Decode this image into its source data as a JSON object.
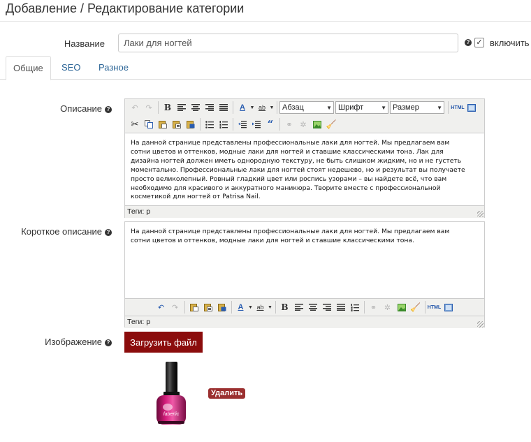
{
  "page": {
    "title": "Добавление / Редактирование категории"
  },
  "form": {
    "name_label": "Название",
    "name_value": "Лаки для ногтей",
    "enable_label": "включить",
    "enable_checked": true
  },
  "tabs": [
    {
      "label": "Общие",
      "active": true
    },
    {
      "label": "SEO",
      "active": false
    },
    {
      "label": "Разное",
      "active": false
    }
  ],
  "description": {
    "label": "Описание",
    "paragraph_select": "Абзац",
    "font_select": "Шрифт",
    "size_select": "Размер",
    "lines": [
      "На данной странице представлены профессиональные лаки для ногтей. Мы предлагаем вам",
      "сотни цветов и оттенков, модные лаки для ногтей и ставшие классическими тона. Лак для",
      "дизайна ногтей должен иметь однородную текстуру, не быть слишком жидким, но и не густеть",
      "моментально. Профессиональные лаки для ногтей стоят недешево, но и результат вы получаете",
      "просто великолепный. Ровный гладкий цвет или роспись узорами – вы найдете всё, что вам",
      "необходимо для красивого и аккуратного маникюра. Творите вместе с профессиональной",
      "косметикой для ногтей от Patrisa Nail."
    ],
    "status": "Теги: p"
  },
  "short_description": {
    "label": "Короткое описание",
    "lines": [
      "На данной странице представлены профессиональные лаки для ногтей. Мы предлагаем вам",
      "сотни цветов и оттенков, модные лаки для ногтей и ставшие классическими тона."
    ],
    "status": "Теги: p"
  },
  "image": {
    "label": "Изображение",
    "upload_label": "Загрузить файл",
    "delete_label": "Удалить",
    "product_text": "faberlic"
  },
  "toolbar_icons": {
    "html": "HTML",
    "quote": "“",
    "bold": "B",
    "font_color": "A",
    "highlight": "ab"
  },
  "colors": {
    "accent": "#8b0c0c",
    "badge": "#9b3030",
    "link": "#2a6496",
    "polish": "#c2186b"
  }
}
